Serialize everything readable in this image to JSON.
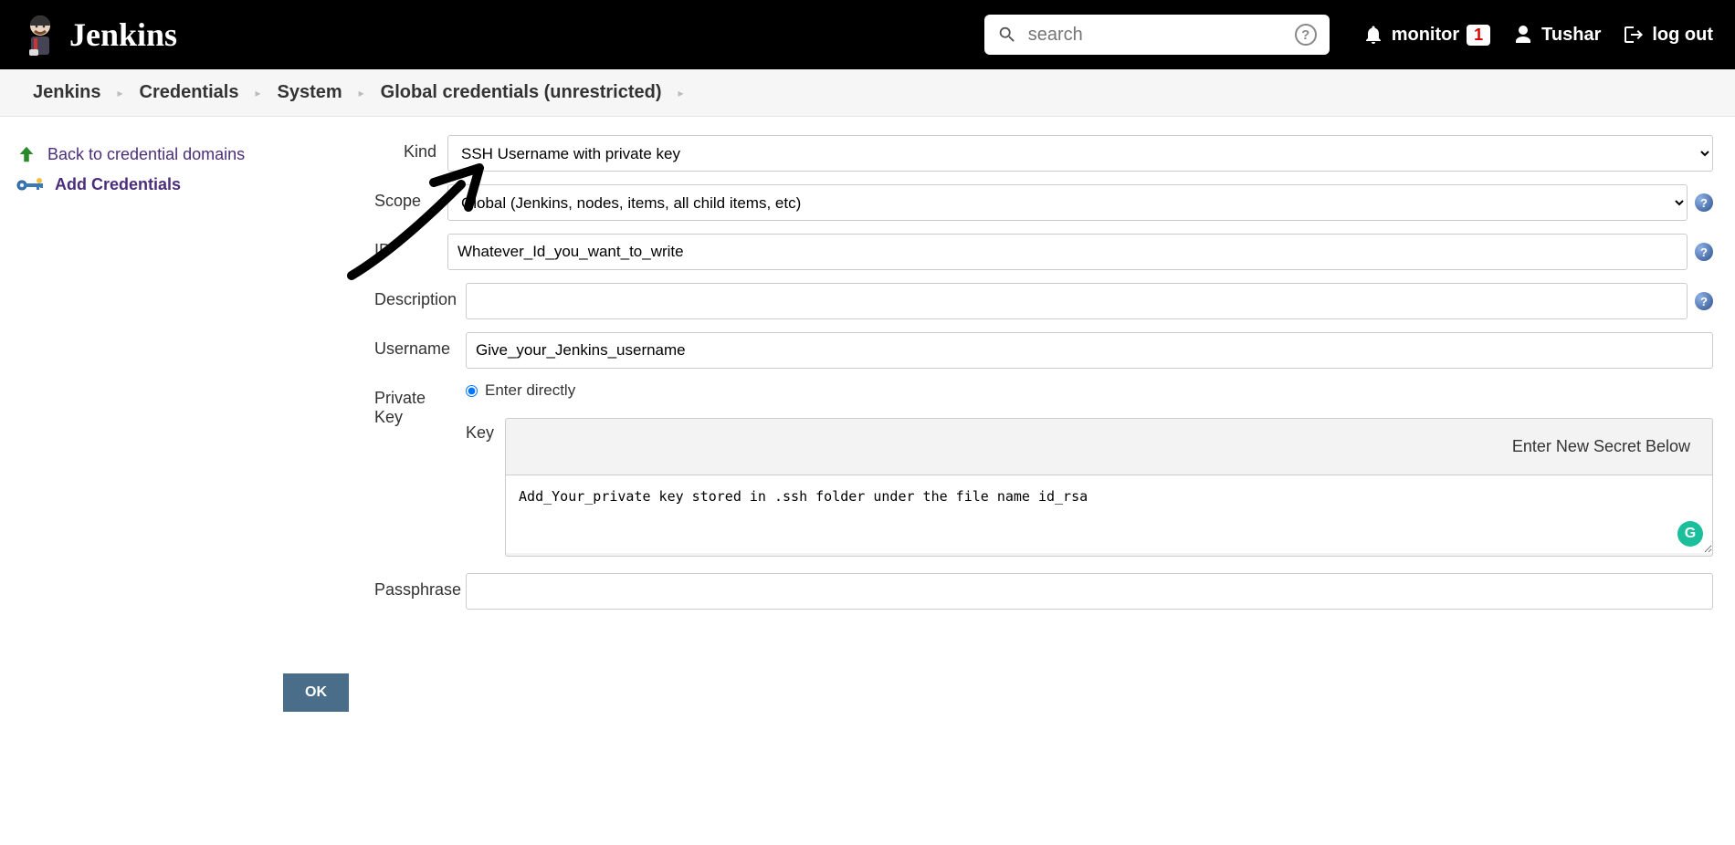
{
  "header": {
    "brand": "Jenkins",
    "search_placeholder": "search",
    "monitor_label": "monitor",
    "monitor_count": "1",
    "user_name": "Tushar",
    "logout_label": "log out"
  },
  "breadcrumbs": [
    "Jenkins",
    "Credentials",
    "System",
    "Global credentials (unrestricted)"
  ],
  "sidebar": {
    "back_label": "Back to credential domains",
    "add_label": "Add Credentials"
  },
  "form": {
    "kind_label": "Kind",
    "kind_value": "SSH Username with private key",
    "scope_label": "Scope",
    "scope_value": "Global (Jenkins, nodes, items, all child items, etc)",
    "id_label": "ID",
    "id_value": "Whatever_Id_you_want_to_write",
    "desc_label": "Description",
    "desc_value": "",
    "user_label": "Username",
    "user_value": "Give_your_Jenkins_username",
    "pk_label": "Private Key",
    "pk_radio": "Enter directly",
    "key_label": "Key",
    "key_header": "Enter New Secret Below",
    "key_value": "Add_Your_private key stored in .ssh folder under the file name id_rsa",
    "pass_label": "Passphrase",
    "pass_value": "",
    "ok_label": "OK"
  }
}
